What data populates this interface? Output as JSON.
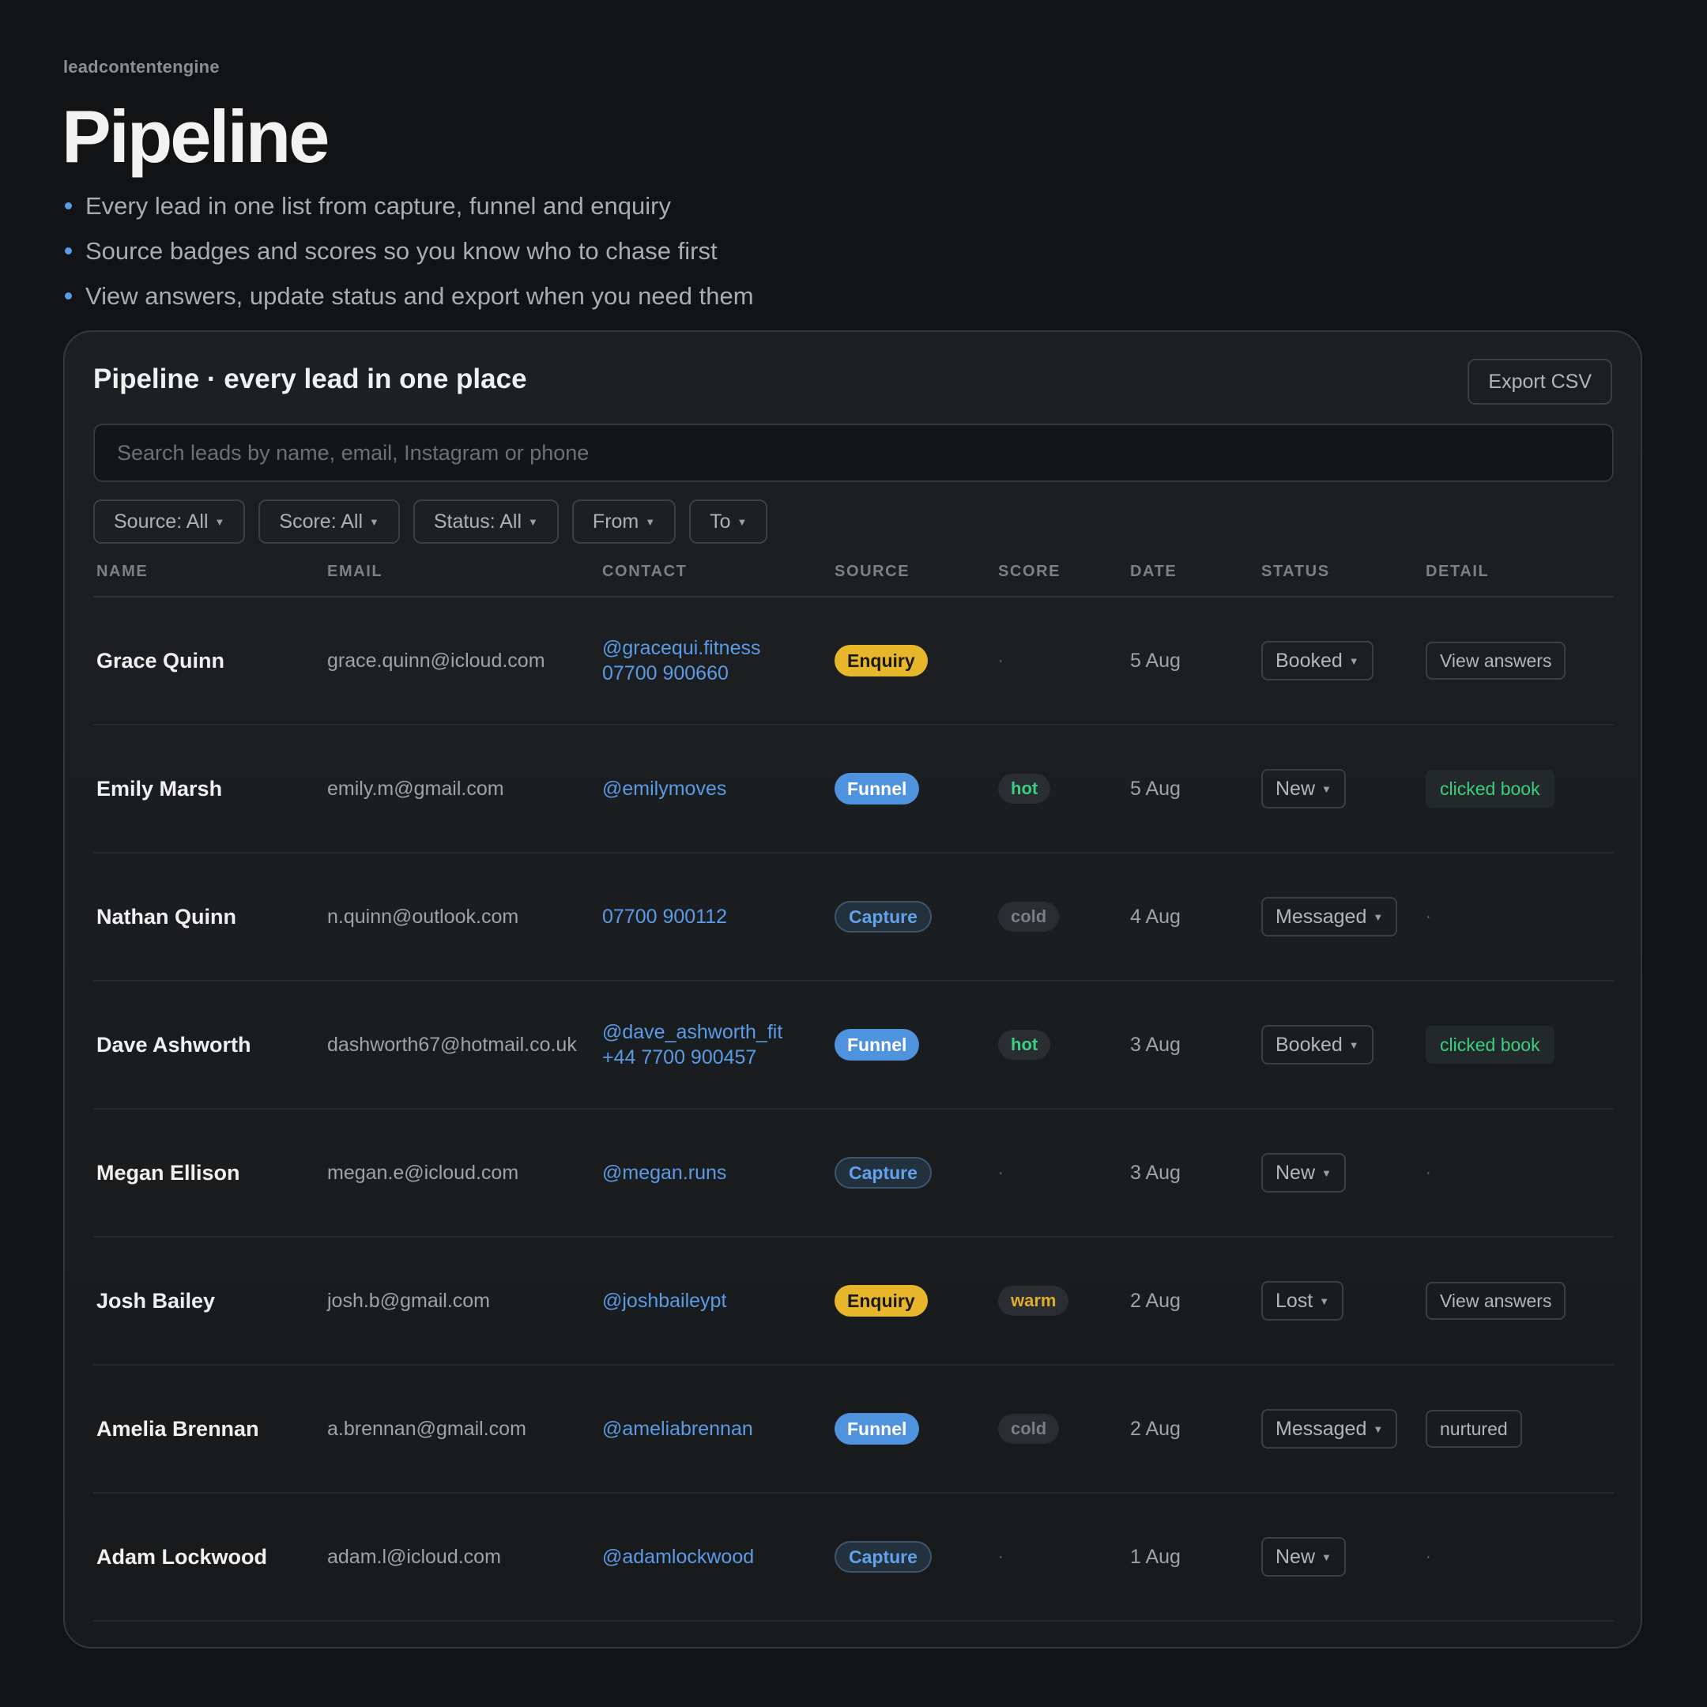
{
  "header": {
    "brand": "leadcontentengine",
    "title": "Pipeline",
    "bullets": [
      "Every lead in one list from capture, funnel and enquiry",
      "Source badges and scores so you know who to chase first",
      "View answers, update status and export when you need them"
    ]
  },
  "panel": {
    "title": "Pipeline · every lead in one place",
    "export_label": "Export CSV",
    "search_placeholder": "Search leads by name, email, Instagram or phone",
    "filters": [
      "Source: All",
      "Score: All",
      "Status: All",
      "From",
      "To"
    ],
    "columns": [
      "NAME",
      "EMAIL",
      "CONTACT",
      "SOURCE",
      "SCORE",
      "DATE",
      "STATUS",
      "DETAIL"
    ]
  },
  "colors": {
    "accent_blue": "#5b9be6",
    "enquiry": "#e8b62a",
    "funnel": "#4f93df",
    "hot": "#3dcf80",
    "warm": "#e0ad2f"
  },
  "rows": [
    {
      "name": "Grace Quinn",
      "email": "grace.quinn@icloud.com",
      "contact": [
        "@gracequi.fitness",
        "07700 900660"
      ],
      "source": "Enquiry",
      "score": "·",
      "date": "5 Aug",
      "status": "Booked",
      "detail": "View answers",
      "detail_type": "button"
    },
    {
      "name": "Emily Marsh",
      "email": "emily.m@gmail.com",
      "contact": [
        "@emilymoves"
      ],
      "source": "Funnel",
      "score": "hot",
      "date": "5 Aug",
      "status": "New",
      "detail": "clicked book",
      "detail_type": "tag"
    },
    {
      "name": "Nathan Quinn",
      "email": "n.quinn@outlook.com",
      "contact": [
        "07700 900112"
      ],
      "source": "Capture",
      "score": "cold",
      "date": "4 Aug",
      "status": "Messaged",
      "detail": "·",
      "detail_type": "none"
    },
    {
      "name": "Dave Ashworth",
      "email": "dashworth67@hotmail.co.uk",
      "contact": [
        "@dave_ashworth_fit",
        "+44 7700 900457"
      ],
      "source": "Funnel",
      "score": "hot",
      "date": "3 Aug",
      "status": "Booked",
      "detail": "clicked book",
      "detail_type": "tag"
    },
    {
      "name": "Megan Ellison",
      "email": "megan.e@icloud.com",
      "contact": [
        "@megan.runs"
      ],
      "source": "Capture",
      "score": "·",
      "date": "3 Aug",
      "status": "New",
      "detail": "·",
      "detail_type": "none"
    },
    {
      "name": "Josh Bailey",
      "email": "josh.b@gmail.com",
      "contact": [
        "@joshbaileypt"
      ],
      "source": "Enquiry",
      "score": "warm",
      "date": "2 Aug",
      "status": "Lost",
      "detail": "View answers",
      "detail_type": "button"
    },
    {
      "name": "Amelia Brennan",
      "email": "a.brennan@gmail.com",
      "contact": [
        "@ameliabrennan"
      ],
      "source": "Funnel",
      "score": "cold",
      "date": "2 Aug",
      "status": "Messaged",
      "detail": "nurtured",
      "detail_type": "button"
    },
    {
      "name": "Adam Lockwood",
      "email": "adam.l@icloud.com",
      "contact": [
        "@adamlockwood"
      ],
      "source": "Capture",
      "score": "·",
      "date": "1 Aug",
      "status": "New",
      "detail": "·",
      "detail_type": "none"
    }
  ]
}
